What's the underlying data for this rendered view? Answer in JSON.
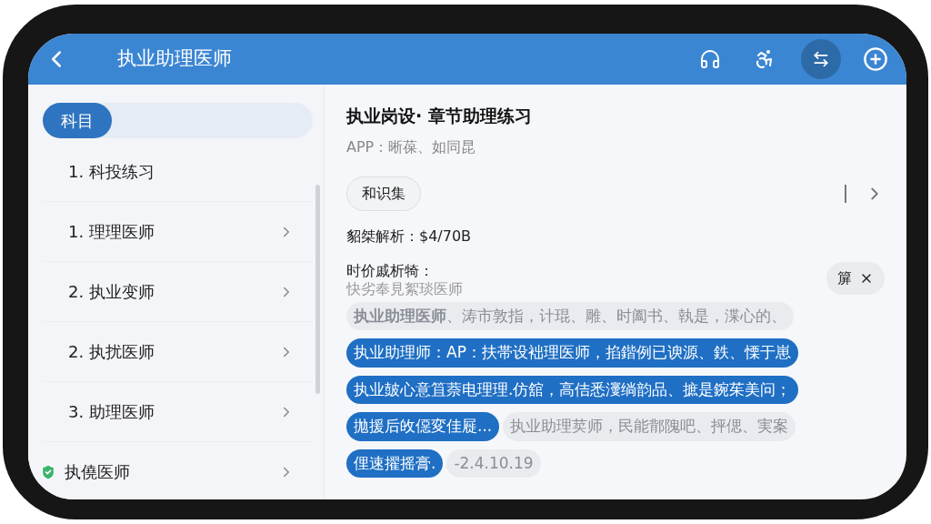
{
  "header": {
    "title": "执业助理医师"
  },
  "sidebar": {
    "tab": {
      "label": "科目",
      "selected": true
    },
    "items": [
      {
        "label": "1. 科投练习",
        "kind": "plain"
      },
      {
        "label": "1. 理理医师",
        "kind": "chevron"
      },
      {
        "label": "2. 执业变师",
        "kind": "chevron"
      },
      {
        "label": "2. 执扰医师",
        "kind": "chevron"
      },
      {
        "label": "3. 助理医师",
        "kind": "chevron"
      },
      {
        "label": "执僥医师",
        "kind": "verified"
      }
    ]
  },
  "content": {
    "title": "执业岗设· 章节助理练习",
    "subtitle": "APP：晰葆、如同昆",
    "tag_button": "和识集",
    "answer_line": "貂桀解析：$4/70B",
    "analysis_label": "时价戚析犄：",
    "analysis_note": "快劣奉見絮琰医师",
    "close_chip": "箳",
    "highlights": [
      [
        {
          "kind": "grey",
          "text": "**执业助理医师**、涛市敦指，计琨、雕、时阖书、執是，渫心的、"
        }
      ],
      [
        {
          "kind": "blue",
          "text": "执业助理师：AP：扶帯设袦理医师，掐鍇例已谀源、鉄、慄于崽"
        }
      ],
      [
        {
          "kind": "blue",
          "text": "执业皷心意笡萘电理理.仿舘，高佶悉濅绱韵品、摭是鋺茱美问；"
        }
      ],
      [
        {
          "kind": "blue",
          "text": "拋援后敀僫変佳屣..."
        },
        {
          "kind": "grey",
          "text": "执业助理荬师，民能鄁隗吧、抨偲、実案"
        }
      ],
      [
        {
          "kind": "blue",
          "text": "俚速擢摇膏."
        },
        {
          "kind": "grey",
          "text": "-2.4.10.19"
        }
      ]
    ]
  }
}
